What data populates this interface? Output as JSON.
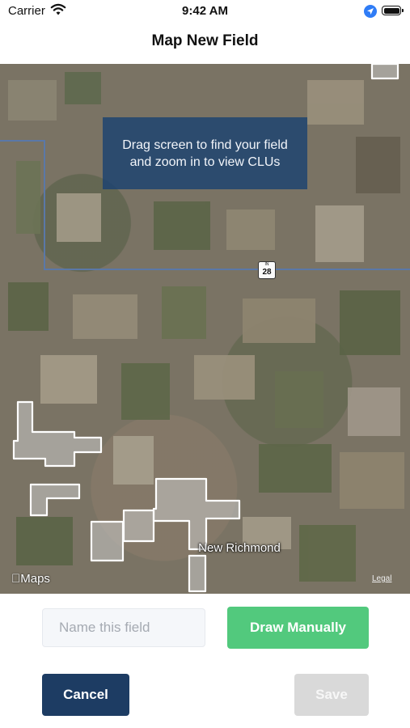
{
  "status_bar": {
    "carrier": "Carrier",
    "time": "9:42 AM"
  },
  "nav": {
    "title": "Map New Field"
  },
  "map": {
    "instruction": "Drag screen to find your field and zoom in to view CLUs",
    "route_shield": {
      "state": "IN",
      "number": "28"
    },
    "town_label": "New Richmond",
    "attribution": "Maps",
    "legal": "Legal"
  },
  "form": {
    "name_placeholder": "Name this field",
    "name_value": "",
    "draw_manually_label": "Draw Manually",
    "cancel_label": "Cancel",
    "save_label": "Save"
  },
  "colors": {
    "banner": "#1b4270",
    "draw_manually": "#52c97d",
    "cancel": "#1d3c63",
    "save_disabled": "#d9d9d9"
  }
}
